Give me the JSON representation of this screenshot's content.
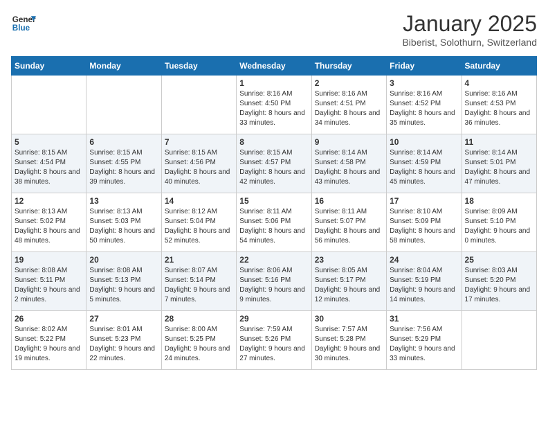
{
  "header": {
    "logo_general": "General",
    "logo_blue": "Blue",
    "month_title": "January 2025",
    "location": "Biberist, Solothurn, Switzerland"
  },
  "days_of_week": [
    "Sunday",
    "Monday",
    "Tuesday",
    "Wednesday",
    "Thursday",
    "Friday",
    "Saturday"
  ],
  "weeks": [
    [
      {
        "day": "",
        "sunrise": "",
        "sunset": "",
        "daylight": ""
      },
      {
        "day": "",
        "sunrise": "",
        "sunset": "",
        "daylight": ""
      },
      {
        "day": "",
        "sunrise": "",
        "sunset": "",
        "daylight": ""
      },
      {
        "day": "1",
        "sunrise": "Sunrise: 8:16 AM",
        "sunset": "Sunset: 4:50 PM",
        "daylight": "Daylight: 8 hours and 33 minutes."
      },
      {
        "day": "2",
        "sunrise": "Sunrise: 8:16 AM",
        "sunset": "Sunset: 4:51 PM",
        "daylight": "Daylight: 8 hours and 34 minutes."
      },
      {
        "day": "3",
        "sunrise": "Sunrise: 8:16 AM",
        "sunset": "Sunset: 4:52 PM",
        "daylight": "Daylight: 8 hours and 35 minutes."
      },
      {
        "day": "4",
        "sunrise": "Sunrise: 8:16 AM",
        "sunset": "Sunset: 4:53 PM",
        "daylight": "Daylight: 8 hours and 36 minutes."
      }
    ],
    [
      {
        "day": "5",
        "sunrise": "Sunrise: 8:15 AM",
        "sunset": "Sunset: 4:54 PM",
        "daylight": "Daylight: 8 hours and 38 minutes."
      },
      {
        "day": "6",
        "sunrise": "Sunrise: 8:15 AM",
        "sunset": "Sunset: 4:55 PM",
        "daylight": "Daylight: 8 hours and 39 minutes."
      },
      {
        "day": "7",
        "sunrise": "Sunrise: 8:15 AM",
        "sunset": "Sunset: 4:56 PM",
        "daylight": "Daylight: 8 hours and 40 minutes."
      },
      {
        "day": "8",
        "sunrise": "Sunrise: 8:15 AM",
        "sunset": "Sunset: 4:57 PM",
        "daylight": "Daylight: 8 hours and 42 minutes."
      },
      {
        "day": "9",
        "sunrise": "Sunrise: 8:14 AM",
        "sunset": "Sunset: 4:58 PM",
        "daylight": "Daylight: 8 hours and 43 minutes."
      },
      {
        "day": "10",
        "sunrise": "Sunrise: 8:14 AM",
        "sunset": "Sunset: 4:59 PM",
        "daylight": "Daylight: 8 hours and 45 minutes."
      },
      {
        "day": "11",
        "sunrise": "Sunrise: 8:14 AM",
        "sunset": "Sunset: 5:01 PM",
        "daylight": "Daylight: 8 hours and 47 minutes."
      }
    ],
    [
      {
        "day": "12",
        "sunrise": "Sunrise: 8:13 AM",
        "sunset": "Sunset: 5:02 PM",
        "daylight": "Daylight: 8 hours and 48 minutes."
      },
      {
        "day": "13",
        "sunrise": "Sunrise: 8:13 AM",
        "sunset": "Sunset: 5:03 PM",
        "daylight": "Daylight: 8 hours and 50 minutes."
      },
      {
        "day": "14",
        "sunrise": "Sunrise: 8:12 AM",
        "sunset": "Sunset: 5:04 PM",
        "daylight": "Daylight: 8 hours and 52 minutes."
      },
      {
        "day": "15",
        "sunrise": "Sunrise: 8:11 AM",
        "sunset": "Sunset: 5:06 PM",
        "daylight": "Daylight: 8 hours and 54 minutes."
      },
      {
        "day": "16",
        "sunrise": "Sunrise: 8:11 AM",
        "sunset": "Sunset: 5:07 PM",
        "daylight": "Daylight: 8 hours and 56 minutes."
      },
      {
        "day": "17",
        "sunrise": "Sunrise: 8:10 AM",
        "sunset": "Sunset: 5:09 PM",
        "daylight": "Daylight: 8 hours and 58 minutes."
      },
      {
        "day": "18",
        "sunrise": "Sunrise: 8:09 AM",
        "sunset": "Sunset: 5:10 PM",
        "daylight": "Daylight: 9 hours and 0 minutes."
      }
    ],
    [
      {
        "day": "19",
        "sunrise": "Sunrise: 8:08 AM",
        "sunset": "Sunset: 5:11 PM",
        "daylight": "Daylight: 9 hours and 2 minutes."
      },
      {
        "day": "20",
        "sunrise": "Sunrise: 8:08 AM",
        "sunset": "Sunset: 5:13 PM",
        "daylight": "Daylight: 9 hours and 5 minutes."
      },
      {
        "day": "21",
        "sunrise": "Sunrise: 8:07 AM",
        "sunset": "Sunset: 5:14 PM",
        "daylight": "Daylight: 9 hours and 7 minutes."
      },
      {
        "day": "22",
        "sunrise": "Sunrise: 8:06 AM",
        "sunset": "Sunset: 5:16 PM",
        "daylight": "Daylight: 9 hours and 9 minutes."
      },
      {
        "day": "23",
        "sunrise": "Sunrise: 8:05 AM",
        "sunset": "Sunset: 5:17 PM",
        "daylight": "Daylight: 9 hours and 12 minutes."
      },
      {
        "day": "24",
        "sunrise": "Sunrise: 8:04 AM",
        "sunset": "Sunset: 5:19 PM",
        "daylight": "Daylight: 9 hours and 14 minutes."
      },
      {
        "day": "25",
        "sunrise": "Sunrise: 8:03 AM",
        "sunset": "Sunset: 5:20 PM",
        "daylight": "Daylight: 9 hours and 17 minutes."
      }
    ],
    [
      {
        "day": "26",
        "sunrise": "Sunrise: 8:02 AM",
        "sunset": "Sunset: 5:22 PM",
        "daylight": "Daylight: 9 hours and 19 minutes."
      },
      {
        "day": "27",
        "sunrise": "Sunrise: 8:01 AM",
        "sunset": "Sunset: 5:23 PM",
        "daylight": "Daylight: 9 hours and 22 minutes."
      },
      {
        "day": "28",
        "sunrise": "Sunrise: 8:00 AM",
        "sunset": "Sunset: 5:25 PM",
        "daylight": "Daylight: 9 hours and 24 minutes."
      },
      {
        "day": "29",
        "sunrise": "Sunrise: 7:59 AM",
        "sunset": "Sunset: 5:26 PM",
        "daylight": "Daylight: 9 hours and 27 minutes."
      },
      {
        "day": "30",
        "sunrise": "Sunrise: 7:57 AM",
        "sunset": "Sunset: 5:28 PM",
        "daylight": "Daylight: 9 hours and 30 minutes."
      },
      {
        "day": "31",
        "sunrise": "Sunrise: 7:56 AM",
        "sunset": "Sunset: 5:29 PM",
        "daylight": "Daylight: 9 hours and 33 minutes."
      },
      {
        "day": "",
        "sunrise": "",
        "sunset": "",
        "daylight": ""
      }
    ]
  ]
}
